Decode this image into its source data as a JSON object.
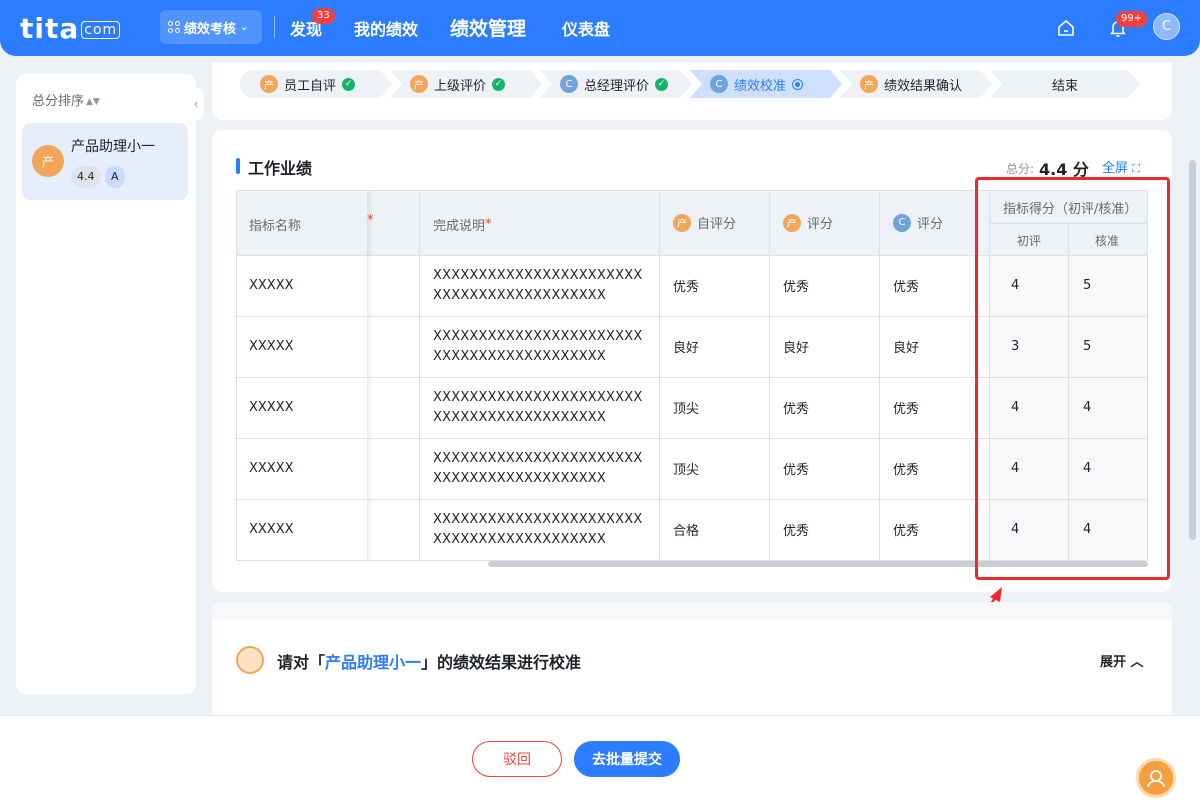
{
  "header": {
    "logo": "tita",
    "logo_suffix": "com",
    "module": "绩效考核",
    "nav": [
      {
        "label": "发现",
        "badge": "33"
      },
      {
        "label": "我的绩效"
      },
      {
        "label": "绩效管理"
      },
      {
        "label": "仪表盘"
      }
    ],
    "notification_badge": "99+",
    "avatar_letter": "C"
  },
  "sidebar": {
    "sort_label": "总分排序",
    "person": {
      "avatar": "产",
      "name": "产品助理小一",
      "score": "4.4",
      "grade": "A"
    }
  },
  "steps": [
    {
      "avatar": "产",
      "label": "员工自评",
      "state": "done"
    },
    {
      "avatar": "产",
      "label": "上级评价",
      "state": "done"
    },
    {
      "avatar": "C",
      "label": "总经理评价",
      "state": "done"
    },
    {
      "avatar": "C",
      "label": "绩效校准",
      "state": "current"
    },
    {
      "avatar": "产",
      "label": "绩效结果确认",
      "state": "todo"
    },
    {
      "label": "结束",
      "state": "todo"
    }
  ],
  "work": {
    "title": "工作业绩",
    "total_label": "总分:",
    "total_value": "4.4 分",
    "fullscreen": "全屏",
    "columns": {
      "name": "指标名称",
      "required_mark": "*",
      "desc": "完成说明",
      "self_avatar": "产",
      "self": "自评分",
      "manager_avatar": "产",
      "manager": "评分",
      "gm_avatar": "C",
      "gm": "评分",
      "group": "指标得分（初评/核准）",
      "initial": "初评",
      "approved": "核准"
    },
    "rows": [
      {
        "name": "XXXXX",
        "desc1": "XXXXXXXXXXXXXXXXXXXXXXX",
        "desc2": "XXXXXXXXXXXXXXXXXXX",
        "self": "优秀",
        "manager": "优秀",
        "gm": "优秀",
        "initial": "4",
        "approved": "5"
      },
      {
        "name": "XXXXX",
        "desc1": "XXXXXXXXXXXXXXXXXXXXXXX",
        "desc2": "XXXXXXXXXXXXXXXXXXX",
        "self": "良好",
        "manager": "良好",
        "gm": "良好",
        "initial": "3",
        "approved": "5"
      },
      {
        "name": "XXXXX",
        "desc1": "XXXXXXXXXXXXXXXXXXXXXXX",
        "desc2": "XXXXXXXXXXXXXXXXXXX",
        "self": "顶尖",
        "manager": "优秀",
        "gm": "优秀",
        "initial": "4",
        "approved": "4"
      },
      {
        "name": "XXXXX",
        "desc1": "XXXXXXXXXXXXXXXXXXXXXXX",
        "desc2": "XXXXXXXXXXXXXXXXXXX",
        "self": "顶尖",
        "manager": "优秀",
        "gm": "优秀",
        "initial": "4",
        "approved": "4"
      },
      {
        "name": "XXXXX",
        "desc1": "XXXXXXXXXXXXXXXXXXXXXXX",
        "desc2": "XXXXXXXXXXXXXXXXXXX",
        "self": "合格",
        "manager": "优秀",
        "gm": "优秀",
        "initial": "4",
        "approved": "4"
      }
    ]
  },
  "calibration": {
    "prefix": "请对「",
    "name": "产品助理小一",
    "suffix": "」的绩效结果进行校准",
    "expand": "展开"
  },
  "footer": {
    "reject": "驳回",
    "submit": "去批量提交"
  },
  "colors": {
    "brand": "#2b7cff",
    "danger": "#f53f3f",
    "success": "#17b26a",
    "annotation": "#f0282d"
  }
}
